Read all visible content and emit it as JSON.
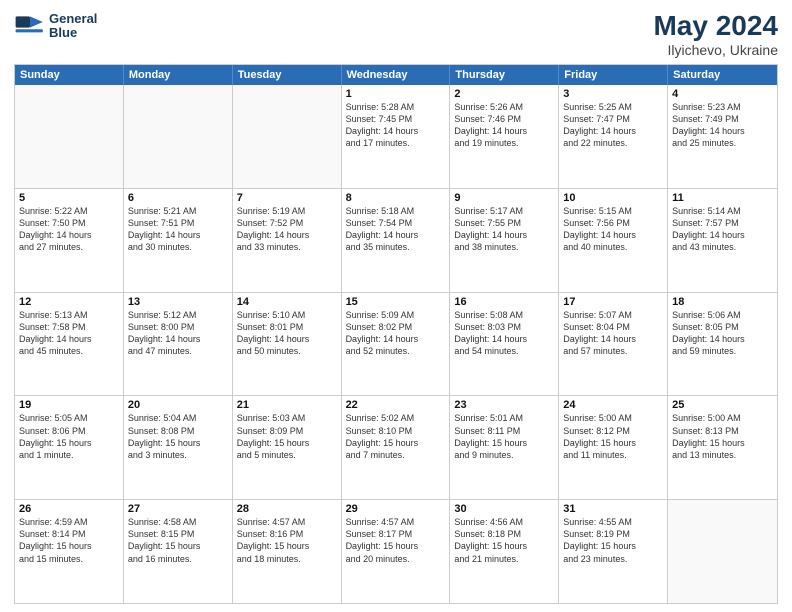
{
  "header": {
    "logo_line1": "General",
    "logo_line2": "Blue",
    "title": "May 2024",
    "location": "Ilyichevo, Ukraine"
  },
  "days_of_week": [
    "Sunday",
    "Monday",
    "Tuesday",
    "Wednesday",
    "Thursday",
    "Friday",
    "Saturday"
  ],
  "weeks": [
    [
      {
        "day": "",
        "lines": []
      },
      {
        "day": "",
        "lines": []
      },
      {
        "day": "",
        "lines": []
      },
      {
        "day": "1",
        "lines": [
          "Sunrise: 5:28 AM",
          "Sunset: 7:45 PM",
          "Daylight: 14 hours",
          "and 17 minutes."
        ]
      },
      {
        "day": "2",
        "lines": [
          "Sunrise: 5:26 AM",
          "Sunset: 7:46 PM",
          "Daylight: 14 hours",
          "and 19 minutes."
        ]
      },
      {
        "day": "3",
        "lines": [
          "Sunrise: 5:25 AM",
          "Sunset: 7:47 PM",
          "Daylight: 14 hours",
          "and 22 minutes."
        ]
      },
      {
        "day": "4",
        "lines": [
          "Sunrise: 5:23 AM",
          "Sunset: 7:49 PM",
          "Daylight: 14 hours",
          "and 25 minutes."
        ]
      }
    ],
    [
      {
        "day": "5",
        "lines": [
          "Sunrise: 5:22 AM",
          "Sunset: 7:50 PM",
          "Daylight: 14 hours",
          "and 27 minutes."
        ]
      },
      {
        "day": "6",
        "lines": [
          "Sunrise: 5:21 AM",
          "Sunset: 7:51 PM",
          "Daylight: 14 hours",
          "and 30 minutes."
        ]
      },
      {
        "day": "7",
        "lines": [
          "Sunrise: 5:19 AM",
          "Sunset: 7:52 PM",
          "Daylight: 14 hours",
          "and 33 minutes."
        ]
      },
      {
        "day": "8",
        "lines": [
          "Sunrise: 5:18 AM",
          "Sunset: 7:54 PM",
          "Daylight: 14 hours",
          "and 35 minutes."
        ]
      },
      {
        "day": "9",
        "lines": [
          "Sunrise: 5:17 AM",
          "Sunset: 7:55 PM",
          "Daylight: 14 hours",
          "and 38 minutes."
        ]
      },
      {
        "day": "10",
        "lines": [
          "Sunrise: 5:15 AM",
          "Sunset: 7:56 PM",
          "Daylight: 14 hours",
          "and 40 minutes."
        ]
      },
      {
        "day": "11",
        "lines": [
          "Sunrise: 5:14 AM",
          "Sunset: 7:57 PM",
          "Daylight: 14 hours",
          "and 43 minutes."
        ]
      }
    ],
    [
      {
        "day": "12",
        "lines": [
          "Sunrise: 5:13 AM",
          "Sunset: 7:58 PM",
          "Daylight: 14 hours",
          "and 45 minutes."
        ]
      },
      {
        "day": "13",
        "lines": [
          "Sunrise: 5:12 AM",
          "Sunset: 8:00 PM",
          "Daylight: 14 hours",
          "and 47 minutes."
        ]
      },
      {
        "day": "14",
        "lines": [
          "Sunrise: 5:10 AM",
          "Sunset: 8:01 PM",
          "Daylight: 14 hours",
          "and 50 minutes."
        ]
      },
      {
        "day": "15",
        "lines": [
          "Sunrise: 5:09 AM",
          "Sunset: 8:02 PM",
          "Daylight: 14 hours",
          "and 52 minutes."
        ]
      },
      {
        "day": "16",
        "lines": [
          "Sunrise: 5:08 AM",
          "Sunset: 8:03 PM",
          "Daylight: 14 hours",
          "and 54 minutes."
        ]
      },
      {
        "day": "17",
        "lines": [
          "Sunrise: 5:07 AM",
          "Sunset: 8:04 PM",
          "Daylight: 14 hours",
          "and 57 minutes."
        ]
      },
      {
        "day": "18",
        "lines": [
          "Sunrise: 5:06 AM",
          "Sunset: 8:05 PM",
          "Daylight: 14 hours",
          "and 59 minutes."
        ]
      }
    ],
    [
      {
        "day": "19",
        "lines": [
          "Sunrise: 5:05 AM",
          "Sunset: 8:06 PM",
          "Daylight: 15 hours",
          "and 1 minute."
        ]
      },
      {
        "day": "20",
        "lines": [
          "Sunrise: 5:04 AM",
          "Sunset: 8:08 PM",
          "Daylight: 15 hours",
          "and 3 minutes."
        ]
      },
      {
        "day": "21",
        "lines": [
          "Sunrise: 5:03 AM",
          "Sunset: 8:09 PM",
          "Daylight: 15 hours",
          "and 5 minutes."
        ]
      },
      {
        "day": "22",
        "lines": [
          "Sunrise: 5:02 AM",
          "Sunset: 8:10 PM",
          "Daylight: 15 hours",
          "and 7 minutes."
        ]
      },
      {
        "day": "23",
        "lines": [
          "Sunrise: 5:01 AM",
          "Sunset: 8:11 PM",
          "Daylight: 15 hours",
          "and 9 minutes."
        ]
      },
      {
        "day": "24",
        "lines": [
          "Sunrise: 5:00 AM",
          "Sunset: 8:12 PM",
          "Daylight: 15 hours",
          "and 11 minutes."
        ]
      },
      {
        "day": "25",
        "lines": [
          "Sunrise: 5:00 AM",
          "Sunset: 8:13 PM",
          "Daylight: 15 hours",
          "and 13 minutes."
        ]
      }
    ],
    [
      {
        "day": "26",
        "lines": [
          "Sunrise: 4:59 AM",
          "Sunset: 8:14 PM",
          "Daylight: 15 hours",
          "and 15 minutes."
        ]
      },
      {
        "day": "27",
        "lines": [
          "Sunrise: 4:58 AM",
          "Sunset: 8:15 PM",
          "Daylight: 15 hours",
          "and 16 minutes."
        ]
      },
      {
        "day": "28",
        "lines": [
          "Sunrise: 4:57 AM",
          "Sunset: 8:16 PM",
          "Daylight: 15 hours",
          "and 18 minutes."
        ]
      },
      {
        "day": "29",
        "lines": [
          "Sunrise: 4:57 AM",
          "Sunset: 8:17 PM",
          "Daylight: 15 hours",
          "and 20 minutes."
        ]
      },
      {
        "day": "30",
        "lines": [
          "Sunrise: 4:56 AM",
          "Sunset: 8:18 PM",
          "Daylight: 15 hours",
          "and 21 minutes."
        ]
      },
      {
        "day": "31",
        "lines": [
          "Sunrise: 4:55 AM",
          "Sunset: 8:19 PM",
          "Daylight: 15 hours",
          "and 23 minutes."
        ]
      },
      {
        "day": "",
        "lines": []
      }
    ]
  ]
}
